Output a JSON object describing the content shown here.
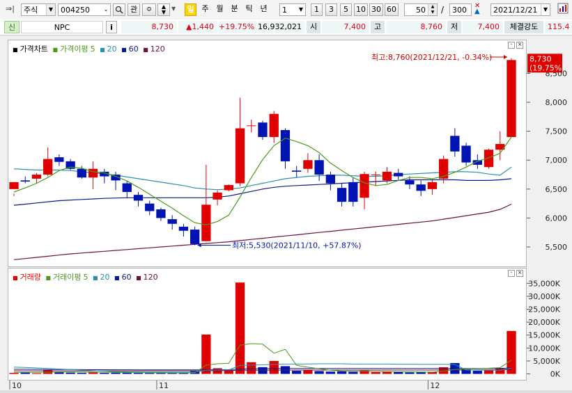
{
  "toolbar": {
    "market_select": "주식",
    "code_input": "004250",
    "btn_gwan": "관",
    "btn_il": "일",
    "btn_ju": "주",
    "btn_wol": "월",
    "btn_bun": "분",
    "btn_tik": "틱",
    "btn_nyeon": "년",
    "period_select": "1",
    "p1": "1",
    "p3": "3",
    "p5": "5",
    "p10": "10",
    "p30": "30",
    "p60": "60",
    "count_input": "50",
    "slash": "/",
    "max_input": "300",
    "date_input": "2021/12/21"
  },
  "quote": {
    "badge": "신",
    "name": "NPC",
    "info_btn": "i",
    "price": "8,730",
    "change": "▲1,440",
    "change_pct": "+19.75%",
    "volume": "16,932,021",
    "open_label": "시",
    "open": "7,400",
    "high_label": "고",
    "high": "8,760",
    "low_label": "저",
    "low": "7,400",
    "strength_label": "체결강도",
    "strength": "115.4"
  },
  "price_panel": {
    "legend": [
      "가격차트",
      "가격이평",
      "5",
      "20",
      "60",
      "120"
    ],
    "max_note": "최고:8,760(2021/12/21, -0.34%)",
    "min_note": "최저:5,530(2021/11/10, +57.87%)",
    "current_price": "8,730",
    "current_pct": "(19.75%)"
  },
  "volume_panel": {
    "legend": [
      "거래량",
      "거래이평",
      "5",
      "20",
      "60",
      "120"
    ]
  },
  "colors": {
    "up": "#e10000",
    "down": "#0014b4",
    "ma5": "#4a9a1a",
    "ma20": "#2a8fb0",
    "ma60": "#0a1a8a",
    "ma120": "#6a1040"
  },
  "chart_data": [
    {
      "type": "candlestick",
      "x_labels": [
        "10",
        "11",
        "12"
      ],
      "y_ticks": [
        5500,
        6000,
        6500,
        7000,
        7500,
        8000,
        8500
      ],
      "y_tick_labels": [
        "5,500",
        "6,000",
        "6,500",
        "7,000",
        "7,500",
        "8,000",
        "8,500"
      ],
      "ylim": [
        5200,
        8950
      ],
      "candles": [
        [
          6500,
          6620,
          6420,
          6380
        ],
        [
          6650,
          6630,
          6720,
          6600
        ],
        [
          6680,
          6750,
          6780,
          6600
        ],
        [
          6750,
          7020,
          7220,
          6720
        ],
        [
          7050,
          6970,
          7100,
          6900
        ],
        [
          6980,
          6850,
          7020,
          6830
        ],
        [
          6850,
          6700,
          6900,
          6680
        ],
        [
          6700,
          6850,
          6980,
          6500
        ],
        [
          6800,
          6720,
          6850,
          6600
        ],
        [
          6750,
          6650,
          6800,
          6480
        ],
        [
          6600,
          6450,
          6640,
          6340
        ],
        [
          6400,
          6300,
          6450,
          6200
        ],
        [
          6250,
          6120,
          6300,
          6050
        ],
        [
          6150,
          6000,
          6180,
          5950
        ],
        [
          5980,
          5900,
          6050,
          5800
        ],
        [
          5850,
          5780,
          5900,
          5680
        ],
        [
          5800,
          5550,
          5850,
          5530
        ],
        [
          5600,
          6230,
          6920,
          5600
        ],
        [
          6320,
          6440,
          6480,
          6220
        ],
        [
          6480,
          6570,
          6580,
          6460
        ],
        [
          6600,
          7550,
          8080,
          6550
        ],
        [
          7590,
          7600,
          7700,
          7480
        ],
        [
          7650,
          7400,
          7680,
          7350
        ],
        [
          7400,
          7800,
          7850,
          7300
        ],
        [
          7520,
          6980,
          7550,
          6850
        ],
        [
          6820,
          6800,
          6900,
          6700
        ],
        [
          6850,
          7000,
          7120,
          6780
        ],
        [
          7000,
          6750,
          7100,
          6640
        ],
        [
          6750,
          6600,
          6800,
          6480
        ],
        [
          6520,
          6280,
          6600,
          6200
        ],
        [
          6620,
          6280,
          6700,
          6200
        ],
        [
          6350,
          6760,
          6800,
          6150
        ],
        [
          6750,
          6750,
          6800,
          6550
        ],
        [
          6650,
          6800,
          6880,
          6600
        ],
        [
          6780,
          6720,
          6850,
          6660
        ],
        [
          6650,
          6580,
          6720,
          6500
        ],
        [
          6580,
          6470,
          6650,
          6380
        ],
        [
          6500,
          6620,
          6660,
          6400
        ],
        [
          6680,
          7020,
          7080,
          6600
        ],
        [
          7420,
          7150,
          7550,
          7060
        ],
        [
          7250,
          6960,
          7300,
          6900
        ],
        [
          7000,
          6920,
          7100,
          6850
        ],
        [
          6880,
          7180,
          7200,
          6850
        ],
        [
          7180,
          7280,
          7500,
          7000
        ],
        [
          7400,
          8730,
          8760,
          7400
        ]
      ],
      "ma5": [
        6450,
        6520,
        6600,
        6700,
        6820,
        6880,
        6860,
        6800,
        6780,
        6720,
        6640,
        6530,
        6410,
        6290,
        6170,
        6040,
        5920,
        5880,
        5940,
        6050,
        6360,
        6700,
        7010,
        7250,
        7380,
        7320,
        7250,
        7130,
        6950,
        6820,
        6700,
        6610,
        6560,
        6580,
        6650,
        6700,
        6700,
        6680,
        6720,
        6790,
        6880,
        6980,
        7040,
        7120,
        7400
      ],
      "ma20": [
        6850,
        6840,
        6830,
        6830,
        6830,
        6820,
        6800,
        6780,
        6760,
        6740,
        6710,
        6680,
        6650,
        6620,
        6590,
        6560,
        6520,
        6500,
        6490,
        6500,
        6520,
        6560,
        6600,
        6640,
        6680,
        6700,
        6720,
        6730,
        6740,
        6740,
        6730,
        6720,
        6720,
        6730,
        6750,
        6760,
        6770,
        6780,
        6790,
        6800,
        6800,
        6790,
        6760,
        6740,
        6880
      ],
      "ma60": [
        6220,
        6240,
        6260,
        6280,
        6300,
        6310,
        6320,
        6330,
        6340,
        6345,
        6350,
        6350,
        6350,
        6350,
        6350,
        6350,
        6350,
        6350,
        6360,
        6380,
        6420,
        6460,
        6500,
        6530,
        6550,
        6560,
        6570,
        6580,
        6590,
        6600,
        6610,
        6620,
        6630,
        6640,
        6650,
        6660,
        6660,
        6660,
        6660,
        6660,
        6650,
        6650,
        6650,
        6660,
        6680
      ],
      "ma120": [
        5280,
        5300,
        5320,
        5340,
        5360,
        5380,
        5395,
        5410,
        5425,
        5440,
        5455,
        5470,
        5485,
        5500,
        5515,
        5530,
        5545,
        5560,
        5575,
        5590,
        5610,
        5630,
        5650,
        5670,
        5690,
        5710,
        5730,
        5750,
        5770,
        5790,
        5810,
        5830,
        5850,
        5870,
        5890,
        5910,
        5930,
        5950,
        5980,
        6010,
        6040,
        6070,
        6100,
        6150,
        6240
      ]
    },
    {
      "type": "bar",
      "title": "거래량",
      "x_labels": [
        "10",
        "11",
        "12"
      ],
      "y_ticks": [
        0,
        5000,
        10000,
        15000,
        20000,
        25000,
        30000,
        35000
      ],
      "y_tick_labels": [
        "0K",
        "5,000K",
        "10,000K",
        "15,000K",
        "20,000K",
        "25,000K",
        "30,000K",
        "35,000K"
      ],
      "ylim": [
        -2000,
        37500
      ],
      "volumes": [
        400,
        600,
        300,
        1500,
        700,
        500,
        400,
        700,
        400,
        500,
        500,
        400,
        350,
        400,
        300,
        350,
        1200,
        15200,
        2200,
        1500,
        35300,
        4500,
        2600,
        5000,
        3000,
        1200,
        1500,
        1100,
        900,
        1000,
        800,
        1300,
        700,
        800,
        700,
        600,
        650,
        800,
        2600,
        4200,
        1800,
        1200,
        1500,
        2300,
        16600
      ],
      "vol_ma5": [
        600,
        620,
        640,
        700,
        720,
        740,
        700,
        700,
        650,
        600,
        540,
        500,
        450,
        420,
        400,
        380,
        420,
        3400,
        3900,
        4100,
        11100,
        11700,
        11500,
        8000,
        9500,
        3300,
        2600,
        2000,
        1400,
        1100,
        1000,
        1000,
        950,
        900,
        850,
        800,
        730,
        700,
        1100,
        1700,
        2000,
        2000,
        2200,
        2400,
        5300
      ],
      "vol_ma20": [
        2600,
        2500,
        2300,
        2100,
        1900,
        1700,
        1500,
        1300,
        1100,
        900,
        800,
        750,
        700,
        700,
        700,
        700,
        700,
        1400,
        1500,
        1550,
        3300,
        3400,
        3500,
        3700,
        3800,
        3800,
        3850,
        3900,
        3900,
        3900,
        3800,
        3800,
        3800,
        3800,
        3750,
        3750,
        3700,
        3700,
        3700,
        3650,
        1500,
        1500,
        1400,
        1450,
        2200
      ],
      "vol_ma60": [
        1800,
        1780,
        1750,
        1720,
        1700,
        1680,
        1660,
        1640,
        1620,
        1600,
        1590,
        1580,
        1570,
        1560,
        1550,
        1550,
        1540,
        1600,
        1620,
        1650,
        1900,
        1950,
        2000,
        2050,
        2100,
        2100,
        2100,
        2100,
        2100,
        2100,
        2100,
        2100,
        2100,
        2100,
        2100,
        2100,
        2100,
        2100,
        2100,
        2100,
        2100,
        2100,
        2100,
        2100,
        2300
      ],
      "vol_ma120": [
        1200,
        1200,
        1200,
        1200,
        1200,
        1200,
        1200,
        1200,
        1200,
        1200,
        1200,
        1200,
        1200,
        1200,
        1200,
        1200,
        1200,
        1250,
        1260,
        1270,
        1400,
        1420,
        1440,
        1460,
        1480,
        1490,
        1500,
        1500,
        1500,
        1500,
        1500,
        1500,
        1500,
        1500,
        1500,
        1500,
        1500,
        1500,
        1510,
        1520,
        1530,
        1540,
        1550,
        1560,
        1650
      ]
    }
  ]
}
